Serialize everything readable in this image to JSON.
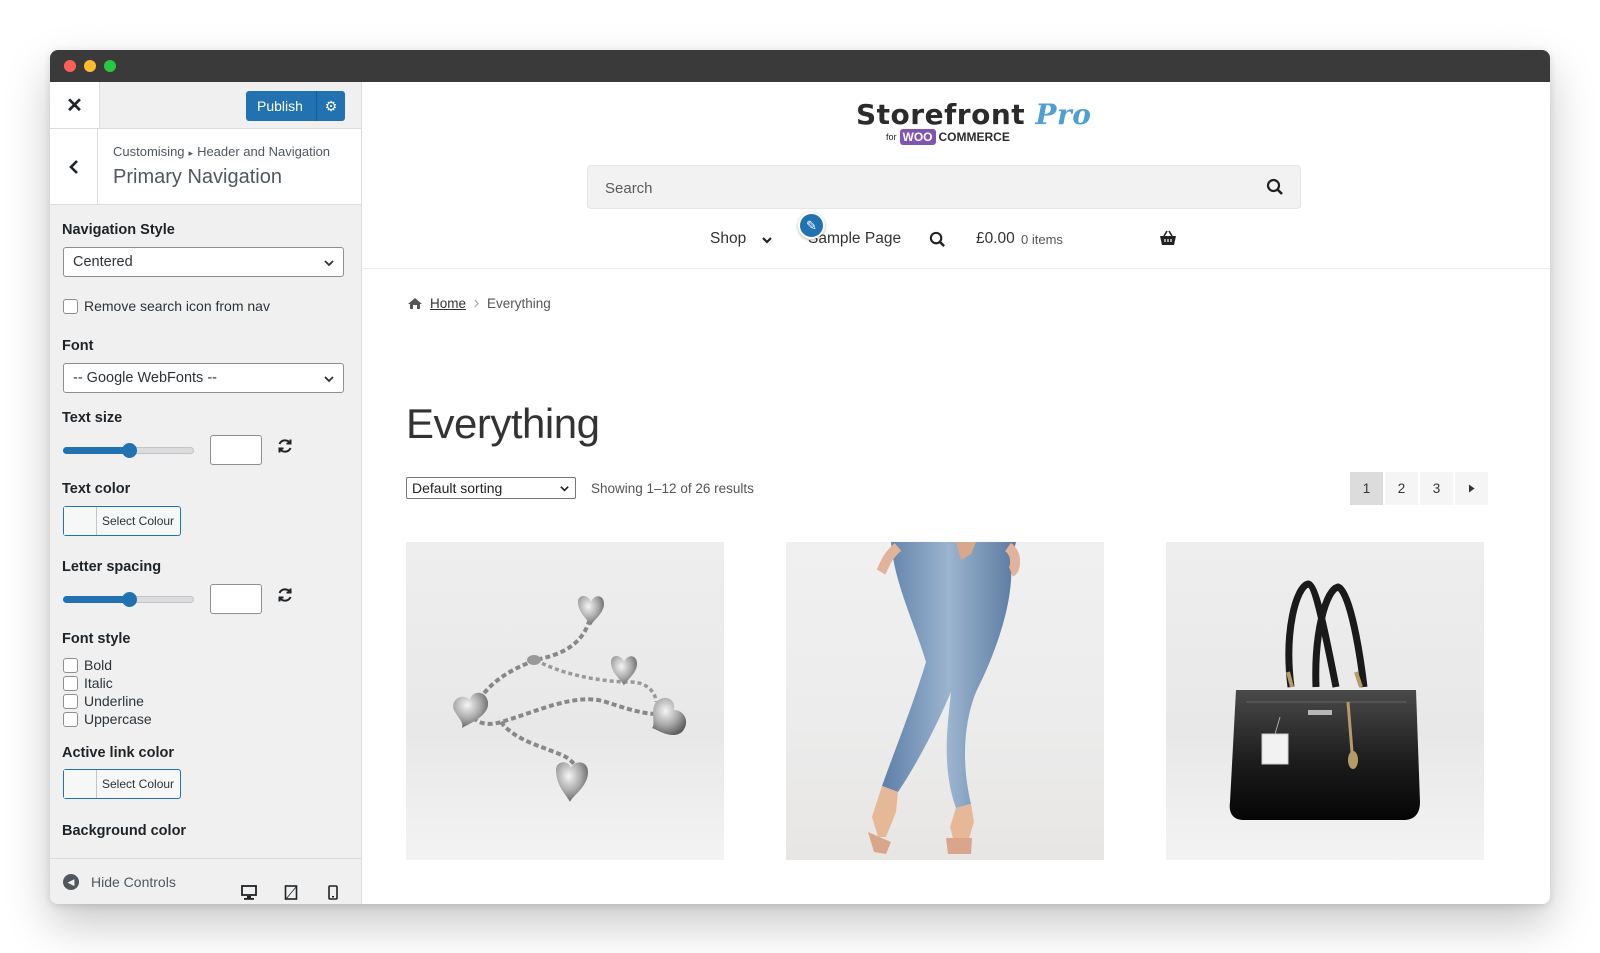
{
  "customizer": {
    "publish_label": "Publish",
    "breadcrumb_root": "Customising",
    "breadcrumb_sep": "▸",
    "breadcrumb_parent": "Header and Navigation",
    "section_title": "Primary Navigation",
    "nav_style_label": "Navigation Style",
    "nav_style_value": "Centered",
    "remove_search_label": "Remove search icon from nav",
    "font_label": "Font",
    "font_value": "-- Google WebFonts --",
    "text_size_label": "Text size",
    "text_size_slider": 0.5,
    "text_color_label": "Text color",
    "select_colour": "Select Colour",
    "letter_spacing_label": "Letter spacing",
    "letter_spacing_slider": 0.5,
    "font_style_label": "Font style",
    "font_styles": [
      "Bold",
      "Italic",
      "Underline",
      "Uppercase"
    ],
    "active_link_color_label": "Active link color",
    "background_color_label": "Background color",
    "hide_controls": "Hide Controls"
  },
  "store": {
    "logo_main": "Storefront",
    "logo_pro": "Pro",
    "logo_for": "for",
    "logo_woo": "WOO",
    "logo_commerce": "COMMERCE",
    "search_placeholder": "Search",
    "nav": {
      "shop": "Shop",
      "sample_page": "Sample Page",
      "cart_amount": "£0.00",
      "cart_items": "0 items"
    },
    "breadcrumb_home": "Home",
    "breadcrumb_current": "Everything",
    "page_title": "Everything",
    "sorting_value": "Default sorting",
    "result_count": "Showing 1–12 of 26 results",
    "pages": [
      "1",
      "2",
      "3"
    ],
    "current_page": "1"
  },
  "colors": {
    "accent": "#2271b1",
    "logo_pro": "#4f9fd3",
    "woo_purple": "#7f54b3"
  }
}
